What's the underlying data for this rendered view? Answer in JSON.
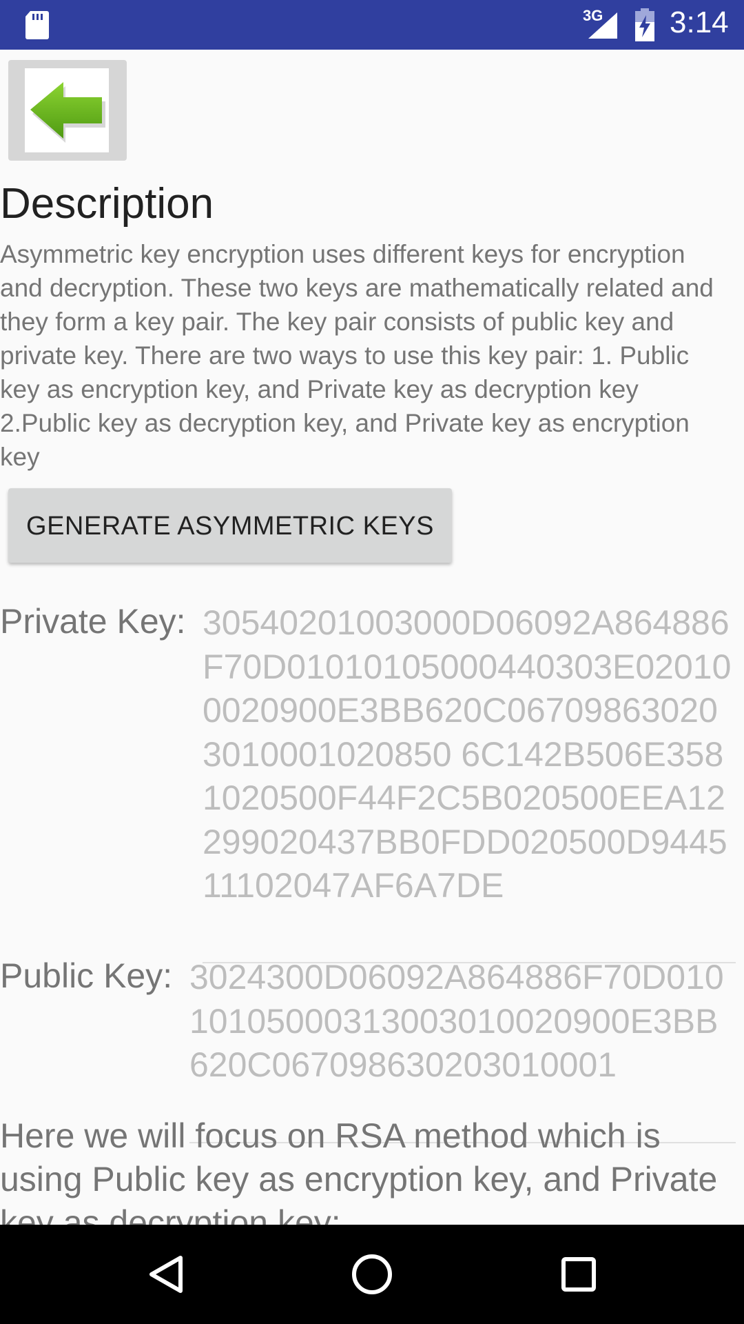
{
  "status_bar": {
    "network_type": "3G",
    "time": "3:14",
    "icons": [
      "sd-card-icon",
      "signal-icon",
      "battery-charging-icon"
    ]
  },
  "toolbar": {
    "back_icon": "green-left-arrow-icon"
  },
  "main": {
    "heading": "Description",
    "description": "Asymmetric key encryption uses different keys for encryption and decryption. These two keys are mathematically related and they form a key pair. The key pair consists of public key and private key. There are two ways to use this key pair: 1. Public key as encryption key, and Private key as decryption key  2.Public key as decryption key, and Private key as encryption key",
    "generate_button_label": "GENERATE ASYMMETRIC KEYS",
    "private_key": {
      "label": "Private Key:",
      "value": "30540201003000D06092A864886F70D01010105000440303E020100020900E3BB620C067098630203010001020850 6C142B506E3581020500F44F2C5B020500EEA12299020437BB0FDD020500D944511102047AF6A7DE"
    },
    "public_key": {
      "label": "Public Key:",
      "value": "3024300D06092A864886F70D01010105000313003010020900E3BB620C067098630203010001"
    },
    "rsa_text": "Here we will focus on RSA method which is using Public key as encryption key, and Private key as decryption key:"
  },
  "nav_bar": {
    "icons": [
      "back-triangle-icon",
      "home-circle-icon",
      "recents-square-icon"
    ]
  }
}
